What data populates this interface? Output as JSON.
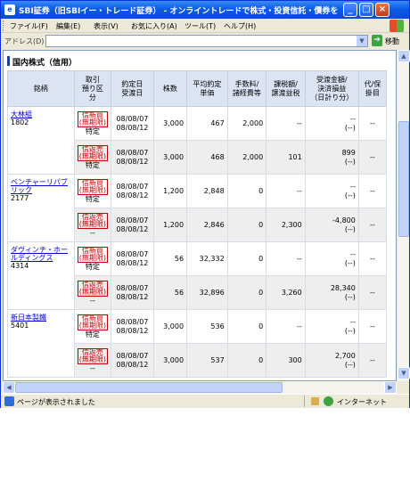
{
  "window": {
    "title": "SBI証券（旧SBIイー・トレード証券） - オンライントレードで株式・投資信託・債券を - - Mi...",
    "minimize": "_",
    "maximize": "□",
    "close": "×"
  },
  "menu": {
    "items": [
      "ファイル(F)",
      "編集(E)",
      "表示(V)",
      "お気に入り(A)",
      "ツール(T)",
      "ヘルプ(H)"
    ]
  },
  "address": {
    "label": "アドレス(D)",
    "value": "",
    "go_label": "移動"
  },
  "section": {
    "title": "国内株式（信用）"
  },
  "table": {
    "headers": {
      "name": "銘柄",
      "kind": [
        "取引",
        "預り区",
        "分"
      ],
      "date": [
        "約定日",
        "受渡日"
      ],
      "qty": "株数",
      "avg": [
        "平均約定",
        "単価"
      ],
      "fee": [
        "手数料/",
        "諸経費等"
      ],
      "tax": [
        "課税額/",
        "譲渡益税"
      ],
      "pl": [
        "受渡金額/",
        "決済損益",
        "（日計り分）"
      ],
      "substitute": [
        "代/保",
        "掛目"
      ]
    },
    "stocks": [
      {
        "name": "大林組",
        "code": "1802",
        "rows": [
          {
            "kind_tag": [
              "信新買",
              "(無期限)"
            ],
            "kind_sub": "特定",
            "trade_date": "08/08/07",
            "settle_date": "08/08/12",
            "qty": "3,000",
            "avg": "467",
            "fee": "2,000",
            "tax": "--",
            "pl": "--",
            "pl_sub": "(--)",
            "substitute": "--"
          },
          {
            "kind_tag": [
              "信返売",
              "(無期限)"
            ],
            "kind_sub": "特定",
            "trade_date": "08/08/07",
            "settle_date": "08/08/12",
            "qty": "3,000",
            "avg": "468",
            "fee": "2,000",
            "tax": "101",
            "pl": "899",
            "pl_sub": "(--)",
            "substitute": "--"
          }
        ]
      },
      {
        "name": "ベンチャーリパブリック",
        "code": "2177",
        "rows": [
          {
            "kind_tag": [
              "信新買",
              "(無期限)"
            ],
            "kind_sub": "特定",
            "trade_date": "08/08/07",
            "settle_date": "08/08/12",
            "qty": "1,200",
            "avg": "2,848",
            "fee": "0",
            "tax": "--",
            "pl": "--",
            "pl_sub": "(--)",
            "substitute": "--"
          },
          {
            "kind_tag": [
              "信返売",
              "(無期限)"
            ],
            "kind_sub": "--",
            "trade_date": "08/08/07",
            "settle_date": "08/08/12",
            "qty": "1,200",
            "avg": "2,846",
            "fee": "0",
            "tax": "2,300",
            "pl": "-4,800",
            "pl_sub": "(--)",
            "substitute": "--"
          }
        ]
      },
      {
        "name": "ダヴィンチ・ホールディングス",
        "code": "4314",
        "rows": [
          {
            "kind_tag": [
              "信新買",
              "(無期限)"
            ],
            "kind_sub": "特定",
            "trade_date": "08/08/07",
            "settle_date": "08/08/12",
            "qty": "56",
            "avg": "32,332",
            "fee": "0",
            "tax": "--",
            "pl": "--",
            "pl_sub": "(--)",
            "substitute": "--"
          },
          {
            "kind_tag": [
              "信返売",
              "(無期限)"
            ],
            "kind_sub": "--",
            "trade_date": "08/08/07",
            "settle_date": "08/08/12",
            "qty": "56",
            "avg": "32,896",
            "fee": "0",
            "tax": "3,260",
            "pl": "28,340",
            "pl_sub": "(--)",
            "substitute": "--"
          }
        ]
      },
      {
        "name": "新日本製鐵",
        "code": "5401",
        "rows": [
          {
            "kind_tag": [
              "信新買",
              "(無期限)"
            ],
            "kind_sub": "特定",
            "trade_date": "08/08/07",
            "settle_date": "08/08/12",
            "qty": "3,000",
            "avg": "536",
            "fee": "0",
            "tax": "--",
            "pl": "--",
            "pl_sub": "(--)",
            "substitute": "--"
          },
          {
            "kind_tag": [
              "信返売",
              "(無期限)"
            ],
            "kind_sub": "--",
            "trade_date": "08/08/07",
            "settle_date": "08/08/12",
            "qty": "3,000",
            "avg": "537",
            "fee": "0",
            "tax": "300",
            "pl": "2,700",
            "pl_sub": "(--)",
            "substitute": "--"
          }
        ]
      }
    ]
  },
  "status": {
    "text": "ページが表示されました",
    "zone": "インターネット"
  },
  "colors": {
    "titlebar": "#0a5ce6",
    "header_bg": "#dce4f3",
    "link": "#0000cc",
    "tag": "#c00000"
  }
}
